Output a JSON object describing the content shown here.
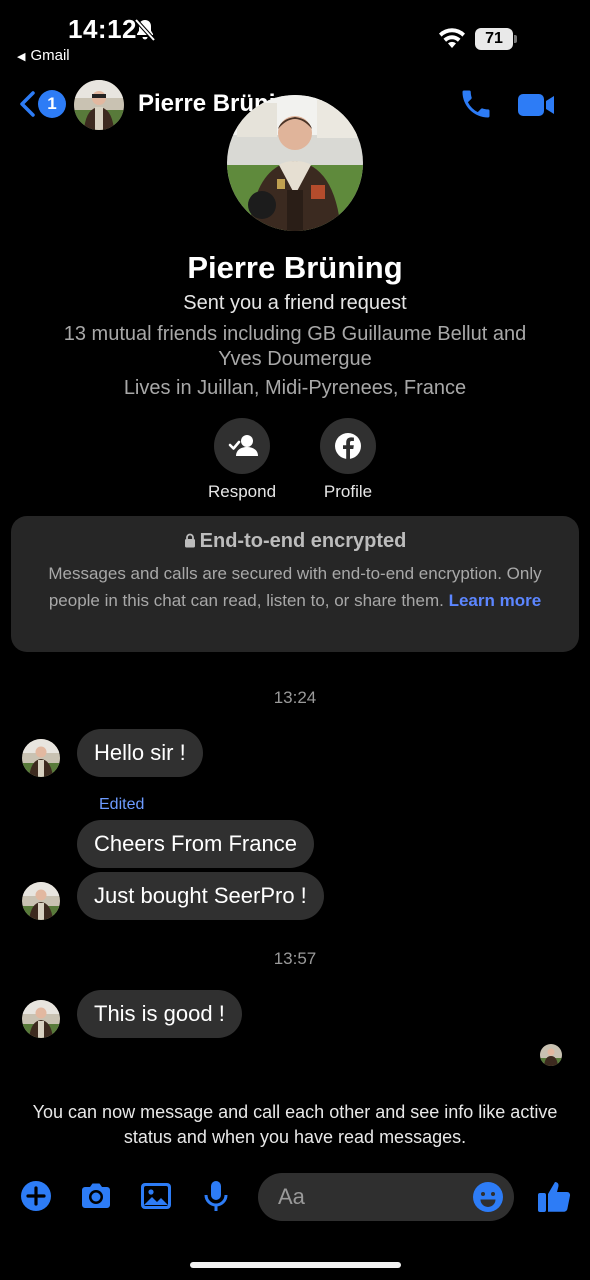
{
  "status_bar": {
    "time": "14:12",
    "back_app": "Gmail",
    "battery": "71"
  },
  "header": {
    "unread_count": "1",
    "contact_name": "Pierre Brüning"
  },
  "profile": {
    "name": "Pierre Brüning",
    "subtitle": "Sent you a friend request",
    "mutual": "13 mutual friends including GB Guillaume Bellut and Yves Doumergue",
    "lives": "Lives in Juillan, Midi-Pyrenees, France",
    "actions": [
      {
        "label": "Respond",
        "icon": "respond-friend-icon"
      },
      {
        "label": "Profile",
        "icon": "facebook-icon"
      }
    ]
  },
  "encryption": {
    "title": "End-to-end encrypted",
    "body": "Messages and calls are secured with end-to-end encryption. Only people in this chat can read, listen to, or share them.",
    "link": "Learn more"
  },
  "messages": {
    "ts1": "13:24",
    "m1": "Hello sir !",
    "edited": "Edited",
    "m2": "Cheers From France",
    "m3": "Just bought SeerPro !",
    "ts2": "13:57",
    "m4": "This is good !"
  },
  "info_note": "You can now message and call each other and see info like active status and when you have read messages.",
  "composer": {
    "placeholder": "Aa"
  },
  "colors": {
    "accent": "#2d7cf6",
    "bubble": "#303030",
    "background": "#000000",
    "link": "#5c86ff"
  }
}
